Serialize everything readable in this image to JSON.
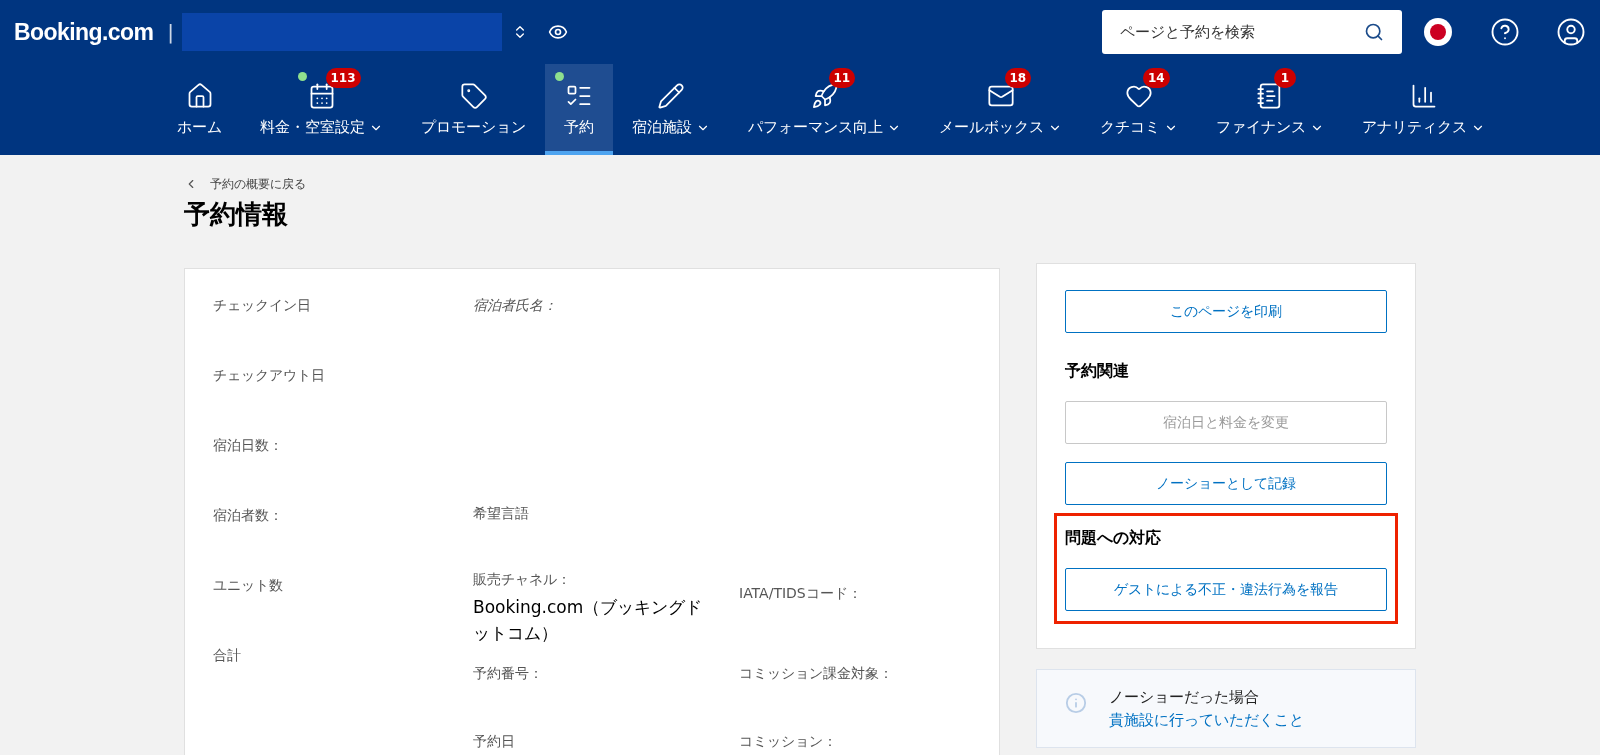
{
  "header": {
    "logo": "Booking.com",
    "separator": "|",
    "search": {
      "placeholder": "ページと予約を検索"
    }
  },
  "nav": [
    {
      "label": "ホーム",
      "dot": false,
      "dropdown": false,
      "selected": false
    },
    {
      "label": "料金・空室設定",
      "badge": "113",
      "dot": true,
      "dropdown": true,
      "selected": false
    },
    {
      "label": "プロモーション",
      "dot": false,
      "dropdown": false,
      "selected": false
    },
    {
      "label": "予約",
      "dot": true,
      "dropdown": false,
      "selected": true
    },
    {
      "label": "宿泊施設",
      "dot": false,
      "dropdown": true,
      "selected": false
    },
    {
      "label": "パフォーマンス向上",
      "badge": "11",
      "dot": false,
      "dropdown": true,
      "selected": false
    },
    {
      "label": "メールボックス",
      "badge": "18",
      "dot": false,
      "dropdown": true,
      "selected": false
    },
    {
      "label": "クチコミ",
      "badge": "14",
      "dot": false,
      "dropdown": true,
      "selected": false
    },
    {
      "label": "ファイナンス",
      "badge": "1",
      "dot": false,
      "dropdown": true,
      "selected": false
    },
    {
      "label": "アナリティクス",
      "dot": false,
      "dropdown": true,
      "selected": false
    }
  ],
  "breadcrumb": "予約の概要に戻る",
  "page_title": "予約情報",
  "details": {
    "left": [
      "チェックイン日",
      "チェックアウト日",
      "宿泊日数：",
      "宿泊者数：",
      "ユニット数",
      "合計"
    ],
    "rows": [
      {
        "middle": {
          "label": "宿泊者氏名：",
          "italic": true
        },
        "right": null
      },
      {
        "middle": {
          "label": "希望言語",
          "italic": false
        },
        "right": null
      },
      {
        "middle": {
          "label": "販売チャネル：",
          "italic": false,
          "value": "Booking.com（ブッキングドットコム）"
        },
        "right": {
          "label": "IATA/TIDSコード：",
          "italic": false
        }
      },
      {
        "middle": {
          "label": "予約番号：",
          "italic": false
        },
        "right": {
          "label": "コミッション課金対象：",
          "italic": false
        }
      },
      {
        "middle": {
          "label": "予約日",
          "italic": false
        },
        "right": {
          "label": "コミッション：",
          "italic": false
        }
      }
    ]
  },
  "actions": {
    "print_button": "このページを印刷",
    "sections": [
      {
        "heading": "予約関連",
        "highlight": false,
        "buttons": [
          {
            "label": "宿泊日と料金を変更",
            "disabled": true
          },
          {
            "label": "ノーショーとして記録",
            "disabled": false
          }
        ]
      },
      {
        "heading": "問題への対応",
        "highlight": true,
        "buttons": [
          {
            "label": "ゲストによる不正・違法行為を報告",
            "disabled": false
          }
        ]
      }
    ]
  },
  "info": {
    "text": "ノーショーだった場合",
    "link": "貴施設に行っていただくこと"
  }
}
